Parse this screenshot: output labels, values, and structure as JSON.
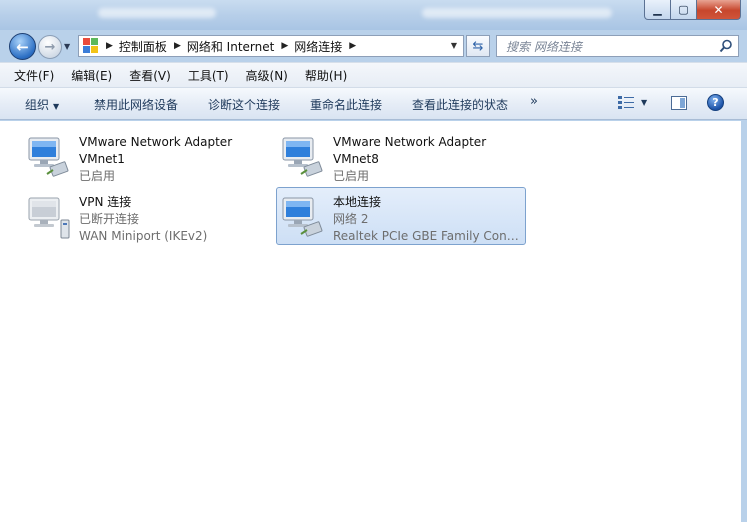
{
  "window": {
    "close_glyph": "✕",
    "minimize_glyph": "▁",
    "maximize_glyph": "▢"
  },
  "nav": {
    "back_glyph": "←",
    "forward_glyph": "→",
    "breadcrumbs": [
      "控制面板",
      "网络和 Internet",
      "网络连接"
    ],
    "search_placeholder": "搜索 网络连接"
  },
  "menu": {
    "items": [
      "文件(F)",
      "编辑(E)",
      "查看(V)",
      "工具(T)",
      "高级(N)",
      "帮助(H)"
    ]
  },
  "commands": {
    "organize": "组织",
    "disable": "禁用此网络设备",
    "diagnose": "诊断这个连接",
    "rename": "重命名此连接",
    "view_status": "查看此连接的状态",
    "more": "»",
    "help": "?"
  },
  "connections": [
    {
      "name": "VMware Network Adapter",
      "line2": "VMnet1",
      "line3": "已启用",
      "icon": "network-adapter-icon"
    },
    {
      "name": "VMware Network Adapter",
      "line2": "VMnet8",
      "line3": "已启用",
      "icon": "network-adapter-icon"
    },
    {
      "name": "VPN 连接",
      "line2": "已断开连接",
      "line3": "WAN Miniport (IKEv2)",
      "icon": "vpn-connection-icon"
    },
    {
      "name": "本地连接",
      "line2": "网络  2",
      "line3": "Realtek PCIe GBE Family Contr...",
      "icon": "network-adapter-icon",
      "selected": true
    }
  ],
  "colors": {
    "accent": "#1e395b",
    "selection": "#cddff5",
    "frame": "#b9d1ea"
  }
}
